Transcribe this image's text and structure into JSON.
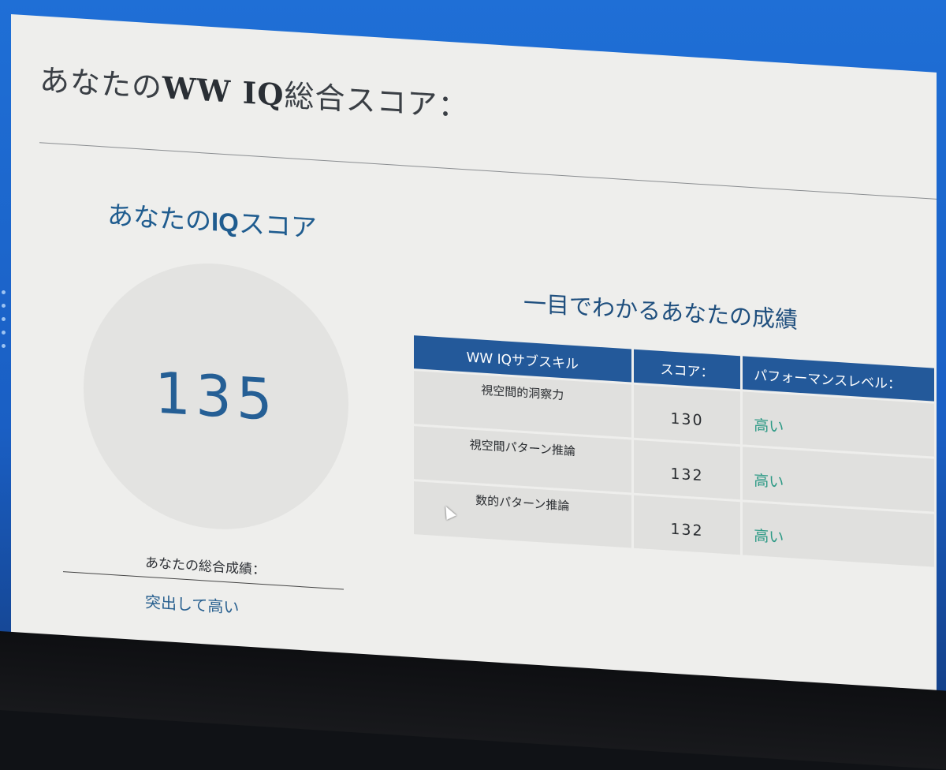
{
  "page": {
    "title_prefix": "あなたの",
    "title_brand": "WW IQ",
    "title_suffix": "総合スコア："
  },
  "iq_panel": {
    "heading_prefix": "あなたの",
    "heading_brand": "IQ",
    "heading_suffix": "スコア",
    "score": "135",
    "overall_label": "あなたの総合成績：",
    "overall_value": "突出して高い"
  },
  "results": {
    "heading": "一目でわかるあなたの成績",
    "columns": [
      "WW IQサブスキル",
      "スコア：",
      "パフォーマンスレベル："
    ],
    "rows": [
      {
        "skill": "視空間的洞察力",
        "score": "130",
        "level": "高い"
      },
      {
        "skill": "視空間パターン推論",
        "score": "132",
        "level": "高い"
      },
      {
        "skill": "数的パターン推論",
        "score": "132",
        "level": "高い"
      }
    ]
  },
  "colors": {
    "header_blue": "#23599a",
    "score_blue": "#255f95",
    "level_green": "#2e9a86",
    "bezel_blue": "#1f6fd6"
  }
}
